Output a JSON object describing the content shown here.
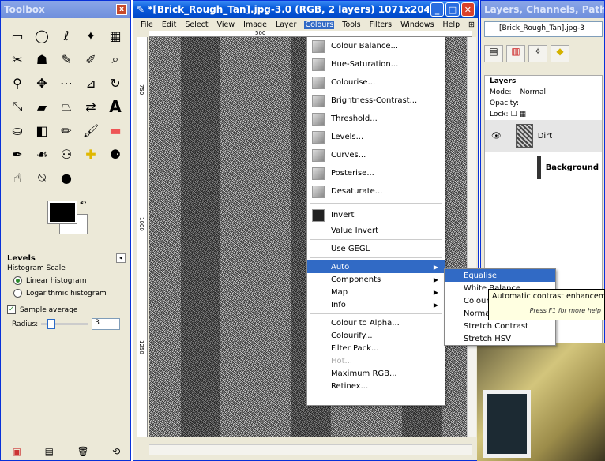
{
  "toolbox": {
    "title": "Toolbox",
    "close": "x",
    "tools": [
      "rect-select",
      "ellipse-select",
      "free-select",
      "fuzzy-select",
      "color-select",
      "scissors",
      "foreground-select",
      "paths",
      "color-picker",
      "zoom",
      "measure",
      "move",
      "align",
      "crop",
      "rotate",
      "scale",
      "shear",
      "perspective",
      "flip",
      "text",
      "bucket-fill",
      "blend",
      "pencil",
      "paintbrush",
      "eraser",
      "airbrush",
      "ink",
      "clone",
      "heal",
      "perspective-clone",
      "smudge",
      "dodge-burn",
      "blur"
    ],
    "levels": {
      "title": "Levels",
      "histogram_scale": "Histogram Scale",
      "linear": "Linear histogram",
      "logarithmic": "Logarithmic histogram",
      "sample_average": "Sample average",
      "radius_label": "Radius:",
      "radius_value": "3"
    }
  },
  "image_window": {
    "title": "*[Brick_Rough_Tan].jpg-3.0 (RGB, 2 layers) 1071x204...",
    "menus": [
      "File",
      "Edit",
      "Select",
      "View",
      "Image",
      "Layer",
      "Colours",
      "Tools",
      "Filters",
      "Windows",
      "Help"
    ],
    "active_menu": "Colours",
    "ruler_mark": "500",
    "v_ruler_marks": [
      "750",
      "1000",
      "1250"
    ]
  },
  "colours_menu": {
    "items": [
      {
        "label": "Colour Balance...",
        "icon": "colour-balance-icon"
      },
      {
        "label": "Hue-Saturation...",
        "icon": "hue-saturation-icon"
      },
      {
        "label": "Colourise...",
        "icon": "colourise-icon"
      },
      {
        "label": "Brightness-Contrast...",
        "icon": "brightness-contrast-icon"
      },
      {
        "label": "Threshold...",
        "icon": "threshold-icon"
      },
      {
        "label": "Levels...",
        "icon": "levels-icon"
      },
      {
        "label": "Curves...",
        "icon": "curves-icon"
      },
      {
        "label": "Posterise...",
        "icon": "posterise-icon"
      },
      {
        "label": "Desaturate...",
        "icon": "desaturate-icon"
      }
    ],
    "invert": "Invert",
    "value_invert": "Value Invert",
    "use_gegl": "Use GEGL",
    "submenus": [
      "Auto",
      "Components",
      "Map",
      "Info"
    ],
    "extras": [
      "Colour to Alpha...",
      "Colourify...",
      "Filter Pack...",
      "Hot...",
      "Maximum RGB...",
      "Retinex..."
    ]
  },
  "auto_menu": {
    "items": [
      "Equalise",
      "White Balance",
      "Colour Enhance",
      "Normalise",
      "Stretch Contrast",
      "Stretch HSV"
    ],
    "selected": "Equalise"
  },
  "tooltip": {
    "text": "Automatic contrast enhancement",
    "hint": "Press F1 for more help"
  },
  "layers_dock": {
    "title": "Layers, Channels, Paths, Undo",
    "image_selector": "[Brick_Rough_Tan].jpg-3",
    "panel_title": "Layers",
    "mode_label": "Mode:",
    "mode_value": "Normal",
    "opacity_label": "Opacity:",
    "lock_label": "Lock:",
    "layers": [
      {
        "name": "Dirt",
        "visible": true
      },
      {
        "name": "Background",
        "visible": false
      }
    ]
  }
}
